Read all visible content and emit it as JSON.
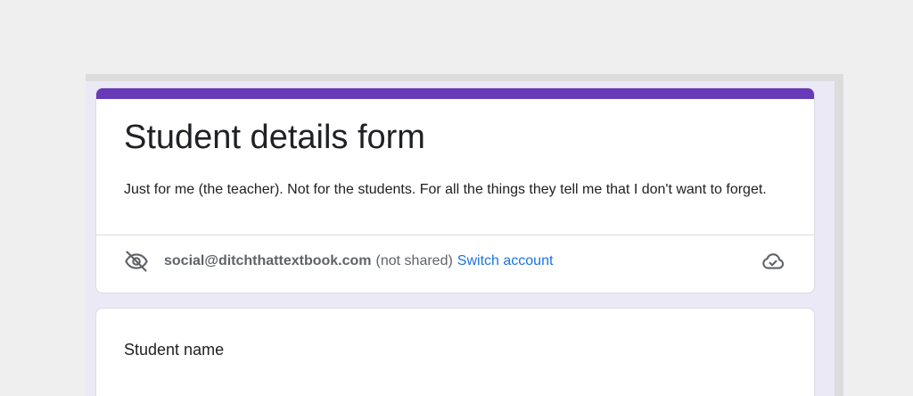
{
  "colors": {
    "accent": "#673ab7",
    "link": "#1a73e8",
    "background": "#efefef",
    "form_background": "#ece9f6"
  },
  "form": {
    "title": "Student details form",
    "description": "Just for me (the teacher). Not for the students. For all the things they tell me that I don't want to forget."
  },
  "account": {
    "icon": "eye-off-icon",
    "email": "social@ditchthattextbook.com",
    "shared_status": "(not shared)",
    "switch_label": "Switch account",
    "save_status_icon": "cloud-check-icon"
  },
  "questions": [
    {
      "label": "Student name"
    }
  ]
}
